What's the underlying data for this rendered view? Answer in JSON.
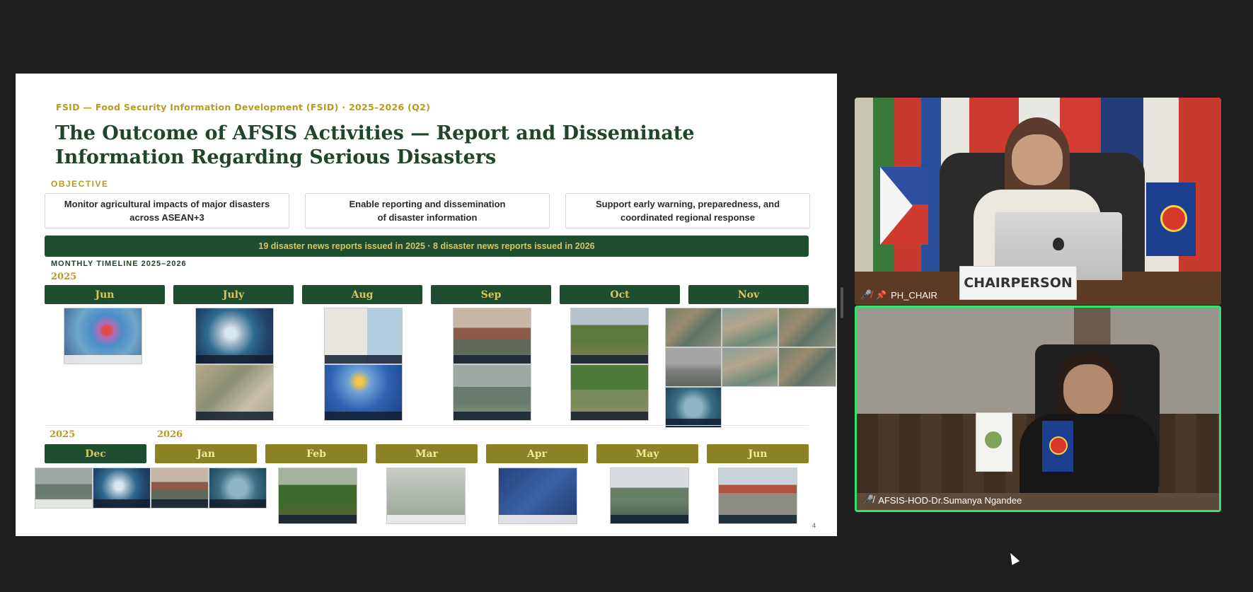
{
  "slide": {
    "header_line": "FSID — Food Security Information Development (FSID) · 2025–2026 (Q2)",
    "title": "The Outcome of AFSIS Activities — Report and Disseminate Information Regarding Serious Disasters",
    "objective_label": "OBJECTIVE",
    "objectives": [
      "Monitor agricultural impacts of major disasters\nacross ASEAN+3",
      "Enable reporting and dissemination\nof disaster information",
      "Support early warning, preparedness, and\ncoordinated regional response"
    ],
    "banner": "19 disaster news reports issued in 2025 · 8 disaster news reports issued in 2026",
    "timeline_label": "MONTHLY TIMELINE 2025–2026",
    "row1_year": "2025",
    "row1_months": [
      "Jun",
      "July",
      "Aug",
      "Sep",
      "Oct",
      "Nov"
    ],
    "row2_year_a": "2025",
    "row2_year_b": "2026",
    "row2_months": [
      "Dec",
      "Jan",
      "Feb",
      "Mar",
      "Apr",
      "May",
      "Jun"
    ],
    "page_number": "4"
  },
  "participants": {
    "top": {
      "name": "PH_CHAIR",
      "sign": "CHAIRPERSON",
      "muted": true
    },
    "bottom": {
      "name": "AFSIS-HOD-Dr.Sumanya Ngandee",
      "muted": true,
      "active_speaker": true
    }
  },
  "colors": {
    "accent_gold": "#b99a1c",
    "dark_green": "#1f4d30",
    "olive": "#8a8223",
    "speaker_border": "#34e26d"
  }
}
